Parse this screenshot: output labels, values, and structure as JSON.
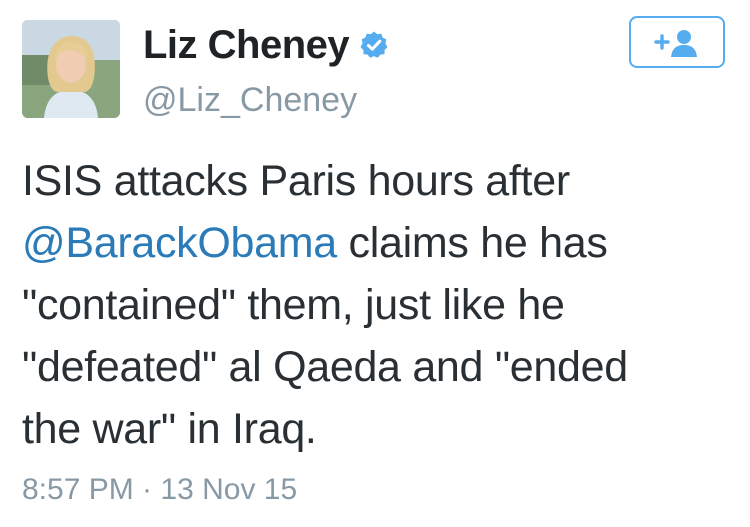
{
  "user": {
    "display_name": "Liz Cheney",
    "handle": "@Liz_Cheney",
    "verified": true,
    "avatar_icon": "profile-photo"
  },
  "follow_button": {
    "icon": "follow-user-plus-icon",
    "accent_color": "#55acee"
  },
  "tweet": {
    "line1": "ISIS attacks Paris hours after",
    "mention": "@BarackObama",
    "line2_rest": " claims he has",
    "line3": "\"contained\" them, just like he",
    "line4": "\"defeated\" al Qaeda and \"ended",
    "line5": "the war\" in Iraq."
  },
  "timestamp": "8:57 PM · 13 Nov 15",
  "colors": {
    "link": "#2b7bb9",
    "muted": "#8899a6",
    "text": "#292f33",
    "verified": "#55acee"
  }
}
